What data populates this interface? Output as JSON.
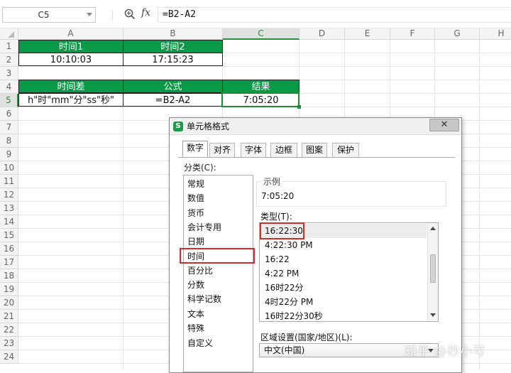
{
  "formula_bar": {
    "name_box": "C5",
    "fx_label": "fx",
    "formula": "=B2-A2"
  },
  "columns": [
    "A",
    "B",
    "C",
    "D",
    "E",
    "F",
    "G",
    "H"
  ],
  "selected_column": "C",
  "rows": [
    "1",
    "2",
    "3",
    "4",
    "5",
    "6",
    "7",
    "8",
    "9",
    "10",
    "11",
    "12",
    "13",
    "14",
    "15",
    "16",
    "17",
    "18",
    "19",
    "20",
    "21",
    "22",
    "23",
    "24"
  ],
  "selected_row": "5",
  "cells": {
    "A1": "时间1",
    "B1": "时间2",
    "A2": "10:10:03",
    "B2": "17:15:23",
    "A4": "时间差",
    "B4": "公式",
    "C4": "结果",
    "A5": "h\"时\"mm\"分\"ss\"秒\"",
    "B5": "=B2-A2",
    "C5": "7:05:20"
  },
  "colors": {
    "header_green": "#0a9a47",
    "selection_green": "#1e8a3a",
    "highlight_red": "#d42b2b"
  },
  "dialog": {
    "title": "单元格格式",
    "logo": "S",
    "close_label": "✕",
    "tabs": [
      "数字",
      "对齐",
      "字体",
      "边框",
      "图案",
      "保护"
    ],
    "active_tab": "数字",
    "category_label": "分类(C):",
    "categories": [
      "常规",
      "数值",
      "货币",
      "会计专用",
      "日期",
      "时间",
      "百分比",
      "分数",
      "科学记数",
      "文本",
      "特殊",
      "自定义"
    ],
    "selected_category": "时间",
    "sample_label": "示例",
    "sample_value": "7:05:20",
    "type_label": "类型(T):",
    "types": [
      "16:22:30",
      "4:22:30 PM",
      "16:22",
      "4:22 PM",
      "16时22分",
      "4时22分 PM",
      "16时22分30秒"
    ],
    "selected_type": "16:22:30",
    "locale_label": "区域设置(国家/地区)(L):",
    "locale_value": "中文(中国)"
  },
  "watermark": "知乎 @秒小可"
}
